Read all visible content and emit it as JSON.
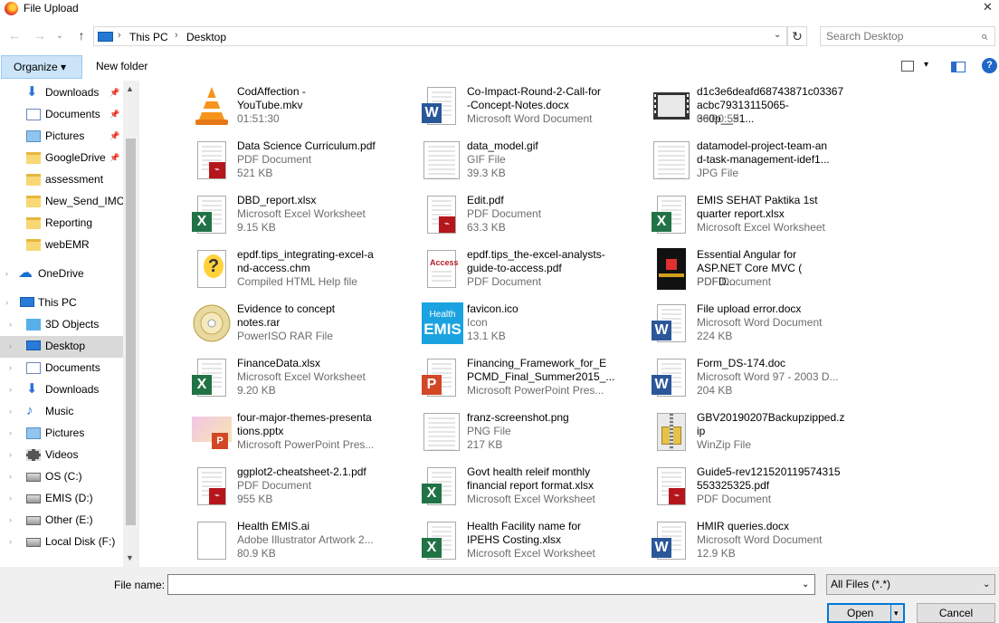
{
  "window": {
    "title": "File Upload",
    "close_glyph": "✕"
  },
  "nav": {
    "back": "←",
    "forward": "→",
    "down": "⌄",
    "up": "↑",
    "breadcrumbs": [
      "This PC",
      "Desktop"
    ],
    "sep": "›",
    "dropdown": "⌄",
    "refresh": "↻"
  },
  "search": {
    "placeholder": "Search Desktop",
    "icon": "⌕"
  },
  "toolbar": {
    "organize": "Organize ▾",
    "new_folder": "New folder"
  },
  "sidebar": {
    "items": [
      {
        "label": "Downloads",
        "icon": "download-arrow-icon",
        "pinned": true
      },
      {
        "label": "Documents",
        "icon": "documents-icon",
        "pinned": true
      },
      {
        "label": "Pictures",
        "icon": "pictures-icon",
        "pinned": true
      },
      {
        "label": "GoogleDrive",
        "icon": "folder-icon",
        "pinned": true
      },
      {
        "label": "assessment",
        "icon": "folder-icon"
      },
      {
        "label": "New_Send_IMC",
        "icon": "folder-icon"
      },
      {
        "label": "Reporting",
        "icon": "folder-icon"
      },
      {
        "label": "webEMR",
        "icon": "folder-icon"
      },
      {
        "label": "OneDrive",
        "icon": "onedrive-cloud-icon"
      },
      {
        "label": "This PC",
        "icon": "computer-icon"
      },
      {
        "label": "3D Objects",
        "icon": "3d-objects-icon"
      },
      {
        "label": "Desktop",
        "icon": "desktop-icon",
        "selected": true
      },
      {
        "label": "Documents",
        "icon": "documents-icon"
      },
      {
        "label": "Downloads",
        "icon": "download-arrow-icon"
      },
      {
        "label": "Music",
        "icon": "music-note-icon"
      },
      {
        "label": "Pictures",
        "icon": "pictures-icon"
      },
      {
        "label": "Videos",
        "icon": "videos-icon"
      },
      {
        "label": "OS (C:)",
        "icon": "drive-icon"
      },
      {
        "label": "EMIS (D:)",
        "icon": "drive-icon"
      },
      {
        "label": "Other (E:)",
        "icon": "drive-icon"
      },
      {
        "label": "Local Disk (F:)",
        "icon": "drive-icon"
      }
    ]
  },
  "files": [
    {
      "name": "CodAffection -\nYouTube.mkv",
      "type": "01:51:30",
      "size": "",
      "kind": "vlc"
    },
    {
      "name": "Co-Impact-Round-2-Call-for\n-Concept-Notes.docx",
      "type": "Microsoft Word Document",
      "size": "",
      "kind": "word"
    },
    {
      "name": "d1c3e6deafd68743871c03367\nacbc79313115065-360p__51...",
      "type": "00:00:59",
      "size": "",
      "kind": "video"
    },
    {
      "name": "Data Science Curriculum.pdf",
      "type": "PDF Document",
      "size": "521 KB",
      "kind": "pdf"
    },
    {
      "name": "data_model.gif",
      "type": "GIF File",
      "size": "39.3 KB",
      "kind": "image"
    },
    {
      "name": "datamodel-project-team-an\nd-task-management-idef1...",
      "type": "JPG File",
      "size": "",
      "kind": "image"
    },
    {
      "name": "DBD_report.xlsx",
      "type": "Microsoft Excel Worksheet",
      "size": "9.15 KB",
      "kind": "excel"
    },
    {
      "name": "Edit.pdf",
      "type": "PDF Document",
      "size": "63.3 KB",
      "kind": "pdf"
    },
    {
      "name": "EMIS SEHAT Paktika 1st\nquarter report.xlsx",
      "type": "Microsoft Excel Worksheet",
      "size": "",
      "kind": "excel"
    },
    {
      "name": "epdf.tips_integrating-excel-a\nnd-access.chm",
      "type": "Compiled HTML Help file",
      "size": "",
      "kind": "chm"
    },
    {
      "name": "epdf.tips_the-excel-analysts-\nguide-to-access.pdf",
      "type": "PDF Document",
      "size": "",
      "kind": "access"
    },
    {
      "name": "Essential Angular for\nASP.NET Core MVC ( PDFD...",
      "type": "PDF Document",
      "size": "",
      "kind": "book"
    },
    {
      "name": "Evidence to concept\nnotes.rar",
      "type": "PowerISO RAR File",
      "size": "",
      "kind": "disc"
    },
    {
      "name": "favicon.ico",
      "type": "Icon",
      "size": "13.1 KB",
      "kind": "emis"
    },
    {
      "name": "File upload error.docx",
      "type": "Microsoft Word Document",
      "size": "224 KB",
      "kind": "word"
    },
    {
      "name": "FinanceData.xlsx",
      "type": "Microsoft Excel Worksheet",
      "size": "9.20 KB",
      "kind": "excel"
    },
    {
      "name": "Financing_Framework_for_E\nPCMD_Final_Summer2015_...",
      "type": "Microsoft PowerPoint Pres...",
      "size": "",
      "kind": "ppt"
    },
    {
      "name": "Form_DS-174.doc",
      "type": "Microsoft Word 97 - 2003 D...",
      "size": "204 KB",
      "kind": "word"
    },
    {
      "name": "four-major-themes-presenta\ntions.pptx",
      "type": "Microsoft PowerPoint Pres...",
      "size": "",
      "kind": "pptimg"
    },
    {
      "name": "franz-screenshot.png",
      "type": "PNG File",
      "size": "217 KB",
      "kind": "image"
    },
    {
      "name": "GBV20190207Backupzipped.z\nip",
      "type": "WinZip File",
      "size": "",
      "kind": "zip"
    },
    {
      "name": "ggplot2-cheatsheet-2.1.pdf",
      "type": "PDF Document",
      "size": "955 KB",
      "kind": "pdf"
    },
    {
      "name": "Govt health releif monthly\nfinancial report format.xlsx",
      "type": "Microsoft Excel Worksheet",
      "size": "",
      "kind": "excel"
    },
    {
      "name": "Guide5-rev121520119574315\n553325325.pdf",
      "type": "PDF Document",
      "size": "",
      "kind": "pdf"
    },
    {
      "name": "Health EMIS.ai",
      "type": "Adobe Illustrator Artwork 2...",
      "size": "80.9 KB",
      "kind": "blank"
    },
    {
      "name": "Health Facility name for\nIPEHS Costing.xlsx",
      "type": "Microsoft Excel Worksheet",
      "size": "",
      "kind": "excel"
    },
    {
      "name": "HMIR queries.docx",
      "type": "Microsoft Word Document",
      "size": "12.9 KB",
      "kind": "word"
    }
  ],
  "bottom": {
    "file_name_label": "File name:",
    "file_name_value": "",
    "file_type": "All Files (*.*)",
    "open": "Open",
    "cancel": "Cancel",
    "dd": "⌄",
    "split": "▾"
  },
  "colors": {
    "word": "#2b579a",
    "excel": "#217346",
    "ppt": "#d24726",
    "pdf": "#b5161c",
    "selection": "#cce4f7"
  }
}
